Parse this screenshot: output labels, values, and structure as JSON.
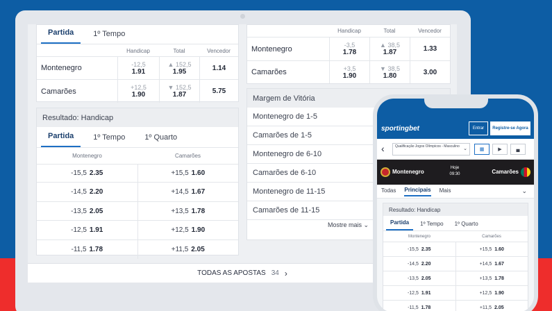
{
  "laptop": {
    "top_card": {
      "tabs": [
        {
          "label": "Partida",
          "active": true
        },
        {
          "label": "1º Tempo",
          "active": false
        }
      ],
      "headers": [
        "Handicap",
        "Total",
        "Vencedor"
      ],
      "rows": [
        {
          "team": "Montenegro",
          "handicap_line": "-12,5",
          "handicap_odd": "1.91",
          "total_line": "▲ 152,5",
          "total_odd": "1.95",
          "winner_odd": "1.14"
        },
        {
          "team": "Camarões",
          "handicap_line": "+12,5",
          "handicap_odd": "1.90",
          "total_line": "▼ 152,5",
          "total_odd": "1.87",
          "winner_odd": "5.75"
        }
      ]
    },
    "right_top_card": {
      "headers": [
        "Handicap",
        "Total",
        "Vencedor"
      ],
      "rows": [
        {
          "team": "Montenegro",
          "handicap_line": "-3,5",
          "handicap_odd": "1.78",
          "total_line": "▲ 38,5",
          "total_odd": "1.87",
          "winner_odd": "1.33"
        },
        {
          "team": "Camarões",
          "handicap_line": "+3,5",
          "handicap_odd": "1.90",
          "total_line": "▼ 38,5",
          "total_odd": "1.80",
          "winner_odd": "3.00"
        }
      ]
    },
    "handicap_card": {
      "title": "Resultado: Handicap",
      "tabs": [
        {
          "label": "Partida",
          "active": true
        },
        {
          "label": "1º Tempo",
          "active": false
        },
        {
          "label": "1º Quarto",
          "active": false
        }
      ],
      "headers": [
        "Montenegro",
        "Camarões"
      ],
      "rows": [
        {
          "l1": "-15,5",
          "o1": "2.35",
          "l2": "+15,5",
          "o2": "1.60"
        },
        {
          "l1": "-14,5",
          "o1": "2.20",
          "l2": "+14,5",
          "o2": "1.67"
        },
        {
          "l1": "-13,5",
          "o1": "2.05",
          "l2": "+13,5",
          "o2": "1.78"
        },
        {
          "l1": "-12,5",
          "o1": "1.91",
          "l2": "+12,5",
          "o2": "1.90"
        },
        {
          "l1": "-11,5",
          "o1": "1.78",
          "l2": "+11,5",
          "o2": "2.05"
        }
      ]
    },
    "margin_card": {
      "title": "Margem de Vitória",
      "items": [
        "Montenegro de 1-5",
        "Camarões de 1-5",
        "Montenegro de 6-10",
        "Camarões de 6-10",
        "Montenegro de 11-15",
        "Camarões de 11-15"
      ],
      "more_label": "Mostre mais"
    },
    "footer": {
      "label": "TODAS AS APOSTAS",
      "count": "34"
    }
  },
  "phone": {
    "brand": "sportingbet",
    "login_label": "Entrar",
    "register_label": "Registre-se Agora",
    "competition": "Qualificação Jogos Olímpicos - Masculino",
    "match": {
      "home": "Montenegro",
      "away": "Camarões",
      "day": "Hoje",
      "time": "09:30"
    },
    "tabs": [
      {
        "label": "Todas",
        "active": false
      },
      {
        "label": "Principais",
        "active": true
      },
      {
        "label": "Mais",
        "active": false
      }
    ],
    "handicap_title": "Resultado: Handicap",
    "handicap_tabs": [
      {
        "label": "Partida",
        "active": true
      },
      {
        "label": "1º Tempo",
        "active": false
      },
      {
        "label": "1º Quarto",
        "active": false
      }
    ],
    "headers": [
      "Montenegro",
      "Camarões"
    ],
    "rows": [
      {
        "l1": "-15,5",
        "o1": "2.35",
        "l2": "+15,5",
        "o2": "1.60"
      },
      {
        "l1": "-14,5",
        "o1": "2.20",
        "l2": "+14,5",
        "o2": "1.67"
      },
      {
        "l1": "-13,5",
        "o1": "2.05",
        "l2": "+13,5",
        "o2": "1.78"
      },
      {
        "l1": "-12,5",
        "o1": "1.91",
        "l2": "+12,5",
        "o2": "1.90"
      },
      {
        "l1": "-11,5",
        "o1": "1.78",
        "l2": "+11,5",
        "o2": "2.05"
      }
    ]
  }
}
